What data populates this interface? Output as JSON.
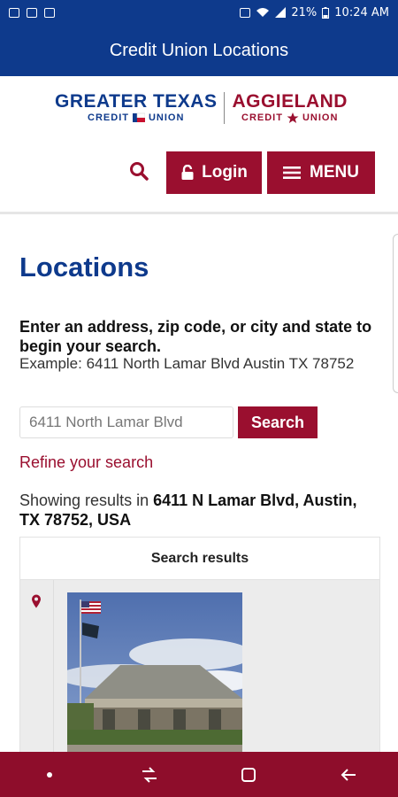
{
  "status_bar": {
    "battery": "21%",
    "time": "10:24 AM"
  },
  "app_bar": {
    "title": "Credit Union Locations"
  },
  "header": {
    "logo_left": {
      "main": "GREATER TEXAS",
      "sub_left": "CREDIT",
      "sub_right": "UNION"
    },
    "logo_right": {
      "main": "AGGIELAND",
      "sub_left": "CREDIT",
      "sub_right": "UNION"
    },
    "login_label": "Login",
    "menu_label": "MENU"
  },
  "locations": {
    "title": "Locations",
    "instruction": "Enter an address, zip code, or city and state to begin your search.",
    "example": "Example: 6411 North Lamar Blvd Austin TX 78752",
    "search_value": "6411 North Lamar Blvd",
    "search_button": "Search",
    "refine_link": "Refine your search",
    "showing_prefix": "Showing results in",
    "showing_address": "6411 N Lamar Blvd, Austin, TX 78752, USA",
    "results_header": "Search results"
  },
  "colors": {
    "brand_blue": "#0e3a8c",
    "brand_maroon": "#9a0f2f",
    "nav_maroon": "#8e0d2b"
  },
  "icons": {
    "search": "search-icon",
    "lock": "lock-icon",
    "menu": "hamburger-icon",
    "pin": "map-pin-icon",
    "home": "home-dot-icon",
    "recents": "recents-icon",
    "overview": "overview-icon",
    "back": "back-icon"
  }
}
